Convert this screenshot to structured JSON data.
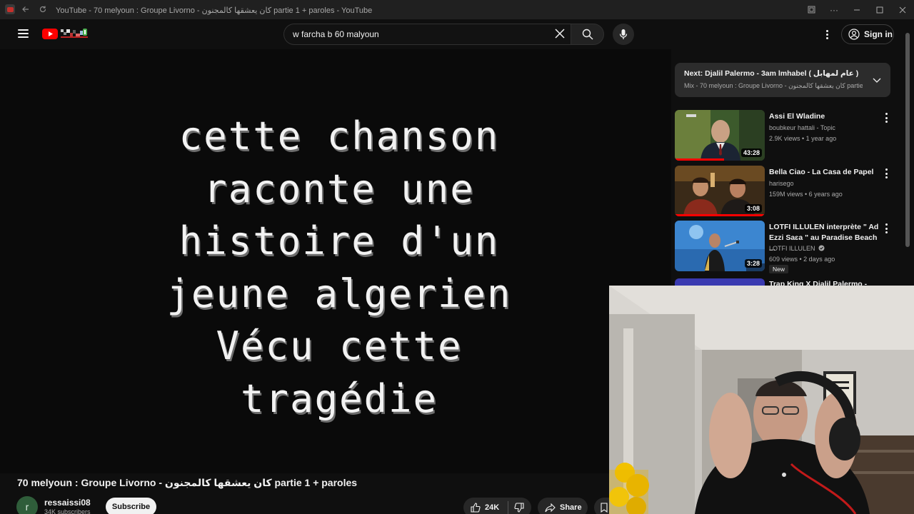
{
  "window": {
    "title": "YouTube - 70 melyoun : Groupe Livorno - كان يعشقها كالمجنون partie 1 + paroles - YouTube"
  },
  "search": {
    "value": "w farcha b 60 malyoun"
  },
  "header": {
    "sign_in_label": "Sign in"
  },
  "player": {
    "lyrics": [
      "cette chanson",
      "raconte une",
      "histoire d'un",
      "jeune algerien",
      "Vécu cette",
      "tragédie"
    ]
  },
  "video": {
    "title": "70 melyoun : Groupe Livorno - كان يعشقها كالمجنون partie 1 + paroles",
    "channel": {
      "avatar_letter": "r",
      "name": "ressaissi08",
      "subscribers": "34K subscribers"
    },
    "subscribe_label": "Subscribe",
    "likes": "24K",
    "share_label": "Share"
  },
  "up_next": {
    "title": "Next: Djalil Palermo - 3am lmhabel ( عام لمهابل )",
    "subtitle": "Mix - 70 melyoun : Groupe Livorno - كان يعشقها كالمجنون partie 1 + p"
  },
  "recommendations": [
    {
      "title": "Assi El Wladine",
      "channel": "boubkeur hattali - Topic",
      "meta": "2.9K views • 1 year ago",
      "duration": "43:28",
      "watched_fraction": 0.55
    },
    {
      "title": "Bella Ciao - La Casa de Papel",
      "channel": "harisego",
      "meta": "159M views • 6 years ago",
      "duration": "3:08",
      "watched_fraction": 1.0
    },
    {
      "title": "LOTFI ILLULEN interprète \" Ad Ezzi Saɛa \" au Paradise Beach ...",
      "channel": "LOTFI ILLULEN",
      "meta": "609 views • 2 days ago",
      "duration": "3:28",
      "badge": "New",
      "watched_fraction": 0
    },
    {
      "title": "Trap King X Djalil Palermo -",
      "channel": "",
      "meta": "",
      "duration": ""
    }
  ],
  "colors": {
    "background": "#0f0f0f",
    "youtube_red": "#ff0000",
    "surface": "#272727"
  }
}
